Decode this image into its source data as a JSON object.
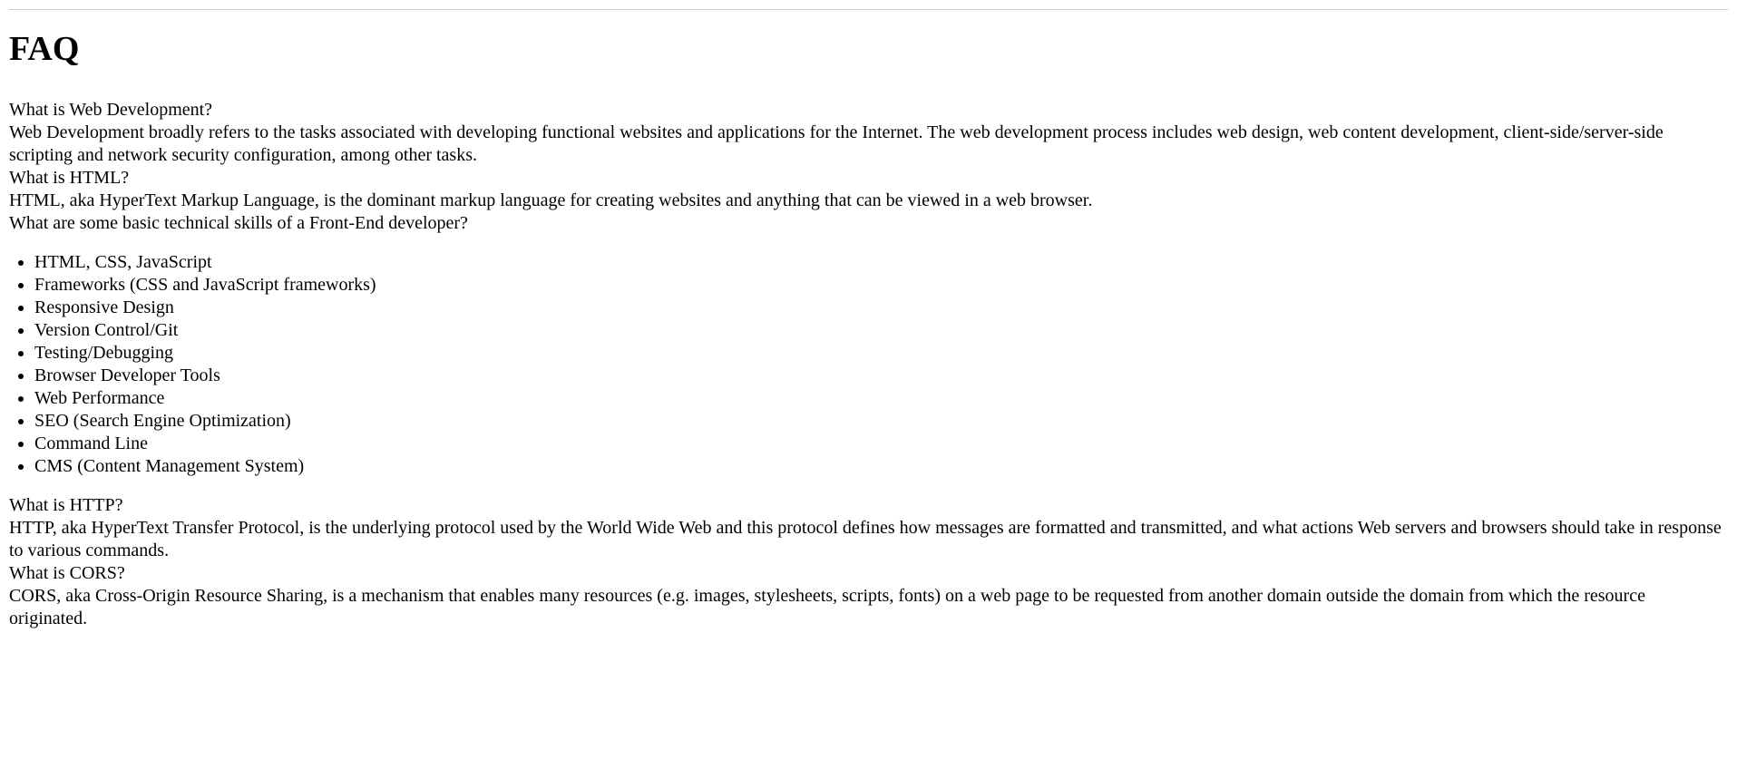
{
  "title": "FAQ",
  "faq": [
    {
      "question": "What is Web Development?",
      "answer": "Web Development broadly refers to the tasks associated with developing functional websites and applications for the Internet. The web development process includes web design, web content development, client-side/server-side scripting and network security configuration, among other tasks."
    },
    {
      "question": "What is HTML?",
      "answer": "HTML, aka HyperText Markup Language, is the dominant markup language for creating websites and anything that can be viewed in a web browser."
    },
    {
      "question": "What are some basic technical skills of a Front-End developer?",
      "answer_list": [
        "HTML, CSS, JavaScript",
        "Frameworks (CSS and JavaScript frameworks)",
        "Responsive Design",
        "Version Control/Git",
        "Testing/Debugging",
        "Browser Developer Tools",
        "Web Performance",
        "SEO (Search Engine Optimization)",
        "Command Line",
        "CMS (Content Management System)"
      ]
    },
    {
      "question": "What is HTTP?",
      "answer": "HTTP, aka HyperText Transfer Protocol, is the underlying protocol used by the World Wide Web and this protocol defines how messages are formatted and transmitted, and what actions Web servers and browsers should take in response to various commands."
    },
    {
      "question": "What is CORS?",
      "answer": "CORS, aka Cross-Origin Resource Sharing, is a mechanism that enables many resources (e.g. images, stylesheets, scripts, fonts) on a web page to be requested from another domain outside the domain from which the resource originated."
    }
  ]
}
